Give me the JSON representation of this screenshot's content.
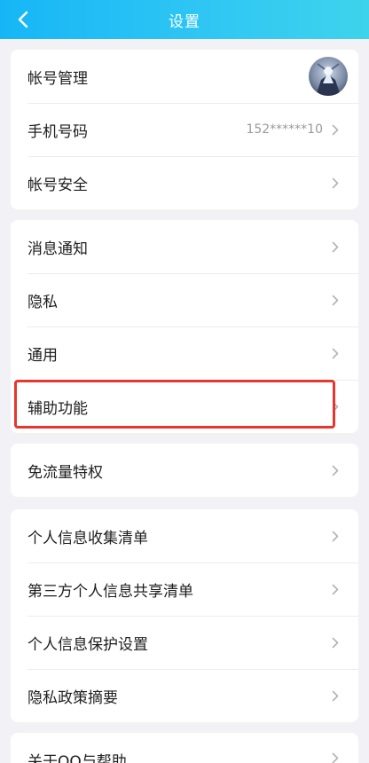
{
  "header": {
    "title": "设置",
    "back_icon": "chevron-left-icon"
  },
  "accent_color": "#e8352e",
  "account_section": {
    "items": [
      {
        "label": "帐号管理",
        "avatar": "user-avatar"
      },
      {
        "label": "手机号码",
        "value": "152******10"
      },
      {
        "label": "帐号安全"
      }
    ]
  },
  "general_section": {
    "items": [
      {
        "label": "消息通知"
      },
      {
        "label": "隐私"
      },
      {
        "label": "通用"
      },
      {
        "label": "辅助功能",
        "highlighted": true
      }
    ]
  },
  "data_section": {
    "items": [
      {
        "label": "免流量特权"
      }
    ]
  },
  "info_section": {
    "items": [
      {
        "label": "个人信息收集清单"
      },
      {
        "label": "第三方个人信息共享清单"
      },
      {
        "label": "个人信息保护设置"
      },
      {
        "label": "隐私政策摘要"
      }
    ]
  },
  "about_section": {
    "items": [
      {
        "label": "关于QQ与帮助"
      }
    ]
  }
}
